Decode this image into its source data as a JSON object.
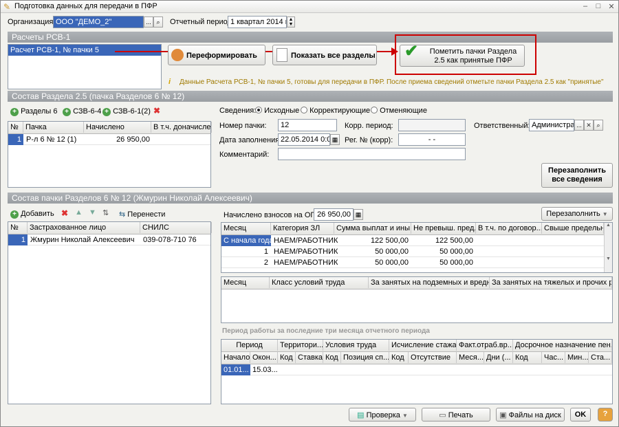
{
  "window": {
    "title": "Подготовка данных для передачи в ПФР",
    "minimize": "–",
    "maximize": "□",
    "close": "✕"
  },
  "header": {
    "org_label": "Организация:",
    "org_value": "ООО \"ДЕМО_2\"",
    "period_label": "Отчетный период:",
    "period_value": "1 квартал 2014 г."
  },
  "rsv": {
    "title": "Расчеты РСВ-1",
    "list": [
      "Расчет РСВ-1, № пачки 5"
    ],
    "btn_reform": "Переформировать",
    "btn_show": "Показать все разделы",
    "btn_mark": "Пометить пачки Раздела 2.5 как принятые ПФР",
    "info": "Данные Расчета РСВ-1, № пачки 5, готовы для передачи в ПФР. После приема сведений отметьте пачки Раздела 2.5 как \"принятые\""
  },
  "s25": {
    "title": "Состав Раздела 2.5    (пачка Разделов 6 № 12)",
    "tb_razd": "Разделы 6",
    "tb_szv64": "СЗВ-6-4",
    "tb_szv61": "СЗВ-6-1(2)",
    "cols": [
      "№",
      "Пачка",
      "Начислено",
      "В т.ч. доначислено"
    ],
    "rows": [
      [
        "1",
        "Р-л 6 № 12 (1)",
        "26 950,00",
        ""
      ]
    ],
    "svedenia_label": "Сведения:",
    "radios": [
      "Исходные",
      "Корректирующие",
      "Отменяющие"
    ],
    "nomer_label": "Номер пачки:",
    "nomer_value": "12",
    "korr_label": "Корр. период:",
    "korr_value": "",
    "otv_label": "Ответственный:",
    "otv_value": "Администрат",
    "data_label": "Дата заполнения:",
    "data_value": "22.05.2014  0:0",
    "reg_label": "Рег. № (корр):",
    "reg_value": "-  -",
    "comment_label": "Комментарий:",
    "comment_value": "",
    "btn_refill_all": "Перезаполнить все сведения"
  },
  "s6": {
    "title": "Состав пачки Разделов 6 № 12      (Жмурин Николай Алексеевич)",
    "tb_add": "Добавить",
    "tb_move": "Перенести",
    "cols": [
      "№",
      "Застрахованное лицо",
      "СНИЛС"
    ],
    "rows": [
      [
        "1",
        "Жмурин Николай Алексеевич",
        "039-078-710 76"
      ]
    ],
    "ops_label": "Начислено взносов на ОПС:",
    "ops_value": "26 950,00",
    "btn_refill": "Перезаполнить",
    "t1_cols": [
      "Месяц",
      "Категория ЗЛ",
      "Сумма выплат и ины...",
      "Не превыш. пред...",
      "В т.ч. по договор...",
      "Свыше предельн..."
    ],
    "t1_rows": [
      [
        "С начала года",
        "НАЕМ/РАБОТНИК",
        "122 500,00",
        "122 500,00",
        "",
        ""
      ],
      [
        "1",
        "НАЕМ/РАБОТНИК",
        "50 000,00",
        "50 000,00",
        "",
        ""
      ],
      [
        "2",
        "НАЕМ/РАБОТНИК",
        "50 000,00",
        "50 000,00",
        "",
        ""
      ]
    ],
    "t2_cols": [
      "Месяц",
      "Класс условий труда",
      "За занятых на подземных и вредн...",
      "За занятых на тяжелых и прочих ра..."
    ],
    "period_title": "Период работы за последние три месяца отчетного периода",
    "t3_groups": [
      "Период",
      "Территори...",
      "Условия труда",
      "Исчисление стажа",
      "Факт.отраб.вр...",
      "Досрочное назначение пен..."
    ],
    "t3_cols": [
      "Начало",
      "Окон...",
      "Код",
      "Ставка",
      "Код",
      "Позиция сп...",
      "Код",
      "Отсутствие",
      "Меся...",
      "Дни (...",
      "Код",
      "Час...",
      "Мин...",
      "Ста..."
    ],
    "t3_rows": [
      [
        "01.01...",
        "15.03..."
      ]
    ]
  },
  "footer": {
    "check": "Проверка",
    "print": "Печать",
    "files": "Файлы на диск",
    "ok": "OK",
    "help": "?"
  }
}
